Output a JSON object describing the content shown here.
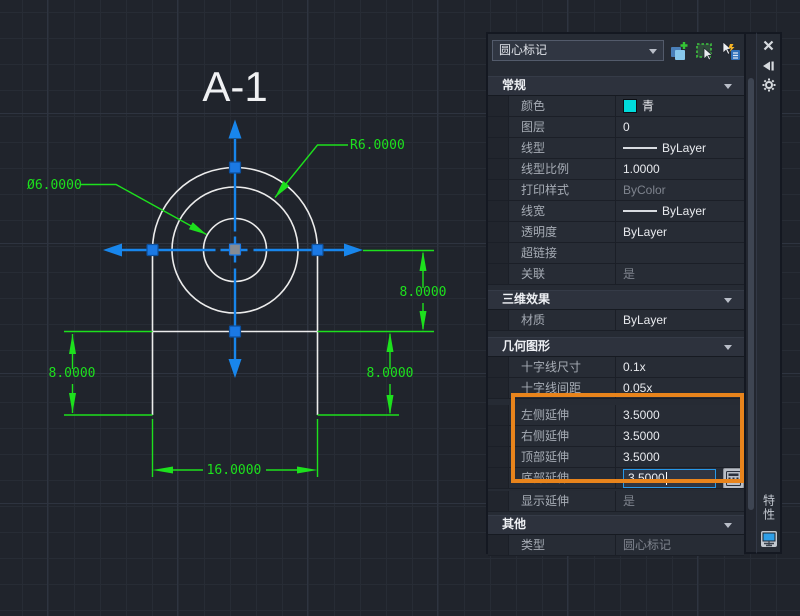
{
  "drawing": {
    "title": "A-1",
    "labels": {
      "radius": "R6.0000",
      "diameter": "Ø6.0000",
      "dim_right_upper": "8.0000",
      "dim_right_lower": "8.0000",
      "dim_left": "8.0000",
      "dim_bottom": "16.0000"
    },
    "colors": {
      "geometry_white": "#ececec",
      "dimension_green": "#1de01d",
      "selection_blue": "#1886ec",
      "grip_blue": "#1b79e4"
    }
  },
  "palette": {
    "title": "特性",
    "selection_dropdown": {
      "value": "圆心标记"
    },
    "toolbar": {
      "icons": [
        "pickadd-toggle",
        "select-objects",
        "quick-select"
      ]
    },
    "titlebar": {
      "icons": [
        "close",
        "auto-hide",
        "settings"
      ]
    },
    "highlight_color": "#e8841c",
    "sections": {
      "general": {
        "label": "常规",
        "rows": {
          "color": {
            "label": "颜色",
            "value": "青",
            "swatch": "#00dcdc"
          },
          "layer": {
            "label": "图层",
            "value": "0"
          },
          "linetype": {
            "label": "线型",
            "value": "ByLayer"
          },
          "ltscale": {
            "label": "线型比例",
            "value": "1.0000"
          },
          "plotstyle": {
            "label": "打印样式",
            "value": "ByColor"
          },
          "lineweight": {
            "label": "线宽",
            "value": "ByLayer"
          },
          "transparency": {
            "label": "透明度",
            "value": "ByLayer"
          },
          "hyperlink": {
            "label": "超链接",
            "value": ""
          },
          "associative": {
            "label": "关联",
            "value": "是"
          }
        }
      },
      "effects3d": {
        "label": "三维效果",
        "rows": {
          "material": {
            "label": "材质",
            "value": "ByLayer"
          }
        }
      },
      "geometry": {
        "label": "几何图形",
        "rows": {
          "cross_size": {
            "label": "十字线尺寸",
            "value": "0.1x"
          },
          "cross_gap": {
            "label": "十字线间距",
            "value": "0.05x"
          },
          "left_ext": {
            "label": "左侧延伸",
            "value": "3.5000"
          },
          "right_ext": {
            "label": "右侧延伸",
            "value": "3.5000"
          },
          "top_ext": {
            "label": "顶部延伸",
            "value": "3.5000"
          },
          "bottom_ext": {
            "label": "底部延伸",
            "value": "3.5000"
          },
          "show_ext": {
            "label": "显示延伸",
            "value": "是"
          }
        }
      },
      "other": {
        "label": "其他",
        "rows": {
          "type": {
            "label": "类型",
            "value": "圆心标记"
          }
        }
      }
    }
  }
}
